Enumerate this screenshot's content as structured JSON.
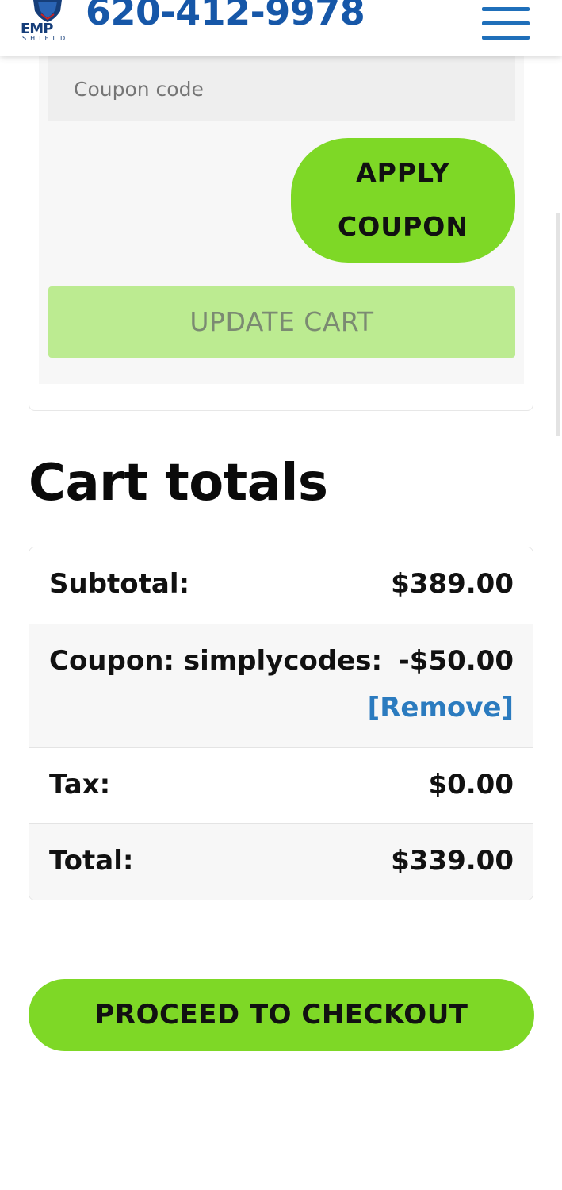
{
  "header": {
    "logo_text": "EMP",
    "logo_sub": "SHIELD",
    "phone": "620-412-9978"
  },
  "coupon": {
    "placeholder": "Coupon code",
    "apply_line1": "APPLY",
    "apply_line2": "COUPON",
    "update_label": "UPDATE CART"
  },
  "cart_totals": {
    "title": "Cart totals",
    "rows": [
      {
        "label": "Subtotal:",
        "value": "$389.00"
      },
      {
        "label": "Coupon: simplycodes:",
        "value": "-$50.00",
        "link": "[Remove]"
      },
      {
        "label": "Tax:",
        "value": "$0.00"
      },
      {
        "label": "Total:",
        "value": "$339.00"
      }
    ]
  },
  "checkout": {
    "label": "PROCEED TO CHECKOUT"
  },
  "colors": {
    "brand_blue": "#1657a8",
    "accent_green": "#7ed826",
    "link_blue": "#2b7bbf"
  },
  "icons": {
    "logo": "shield-logo-icon",
    "menu": "hamburger-menu-icon"
  }
}
